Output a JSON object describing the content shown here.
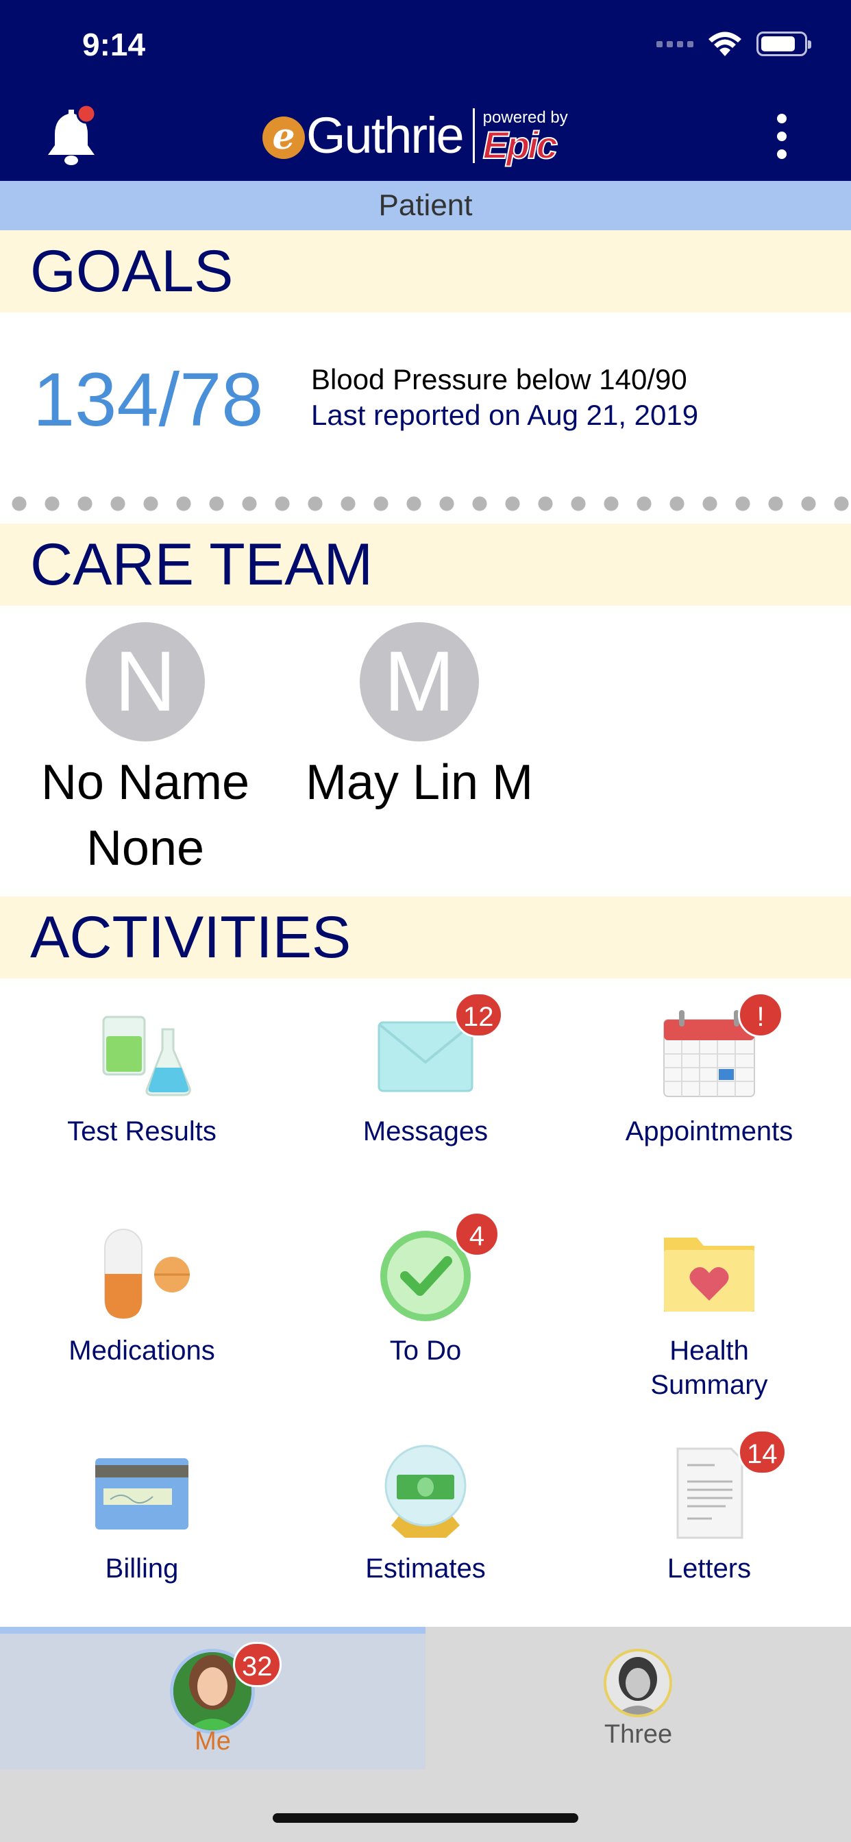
{
  "status_bar": {
    "time": "9:14"
  },
  "header": {
    "logo_e": "e",
    "logo_brand": "Guthrie",
    "logo_powered_by": "powered by",
    "logo_partner": "Epic"
  },
  "patient_bar": {
    "label": "Patient"
  },
  "goals": {
    "heading": "GOALS",
    "value": "134/78",
    "title": "Blood Pressure below 140/90",
    "last_reported": "Last reported on Aug 21, 2019"
  },
  "care_team": {
    "heading": "CARE TEAM",
    "members": [
      {
        "initial": "N",
        "name_line1": "No Name",
        "name_line2": "None"
      },
      {
        "initial": "M",
        "name_line1": "May Lin M",
        "name_line2": ""
      }
    ]
  },
  "activities": {
    "heading": "ACTIVITIES",
    "items": [
      {
        "label": "Test Results",
        "icon": "test-results-icon",
        "badge": ""
      },
      {
        "label": "Messages",
        "icon": "envelope-icon",
        "badge": "12"
      },
      {
        "label": "Appointments",
        "icon": "calendar-icon",
        "badge": "!"
      },
      {
        "label": "Medications",
        "icon": "pill-icon",
        "badge": ""
      },
      {
        "label": "To Do",
        "icon": "checkmark-icon",
        "badge": "4"
      },
      {
        "label": "Health Summary",
        "label_line1": "Health",
        "label_line2": "Summary",
        "icon": "folder-heart-icon",
        "badge": ""
      },
      {
        "label": "Billing",
        "icon": "credit-card-icon",
        "badge": ""
      },
      {
        "label": "Estimates",
        "icon": "estimate-globe-icon",
        "badge": ""
      },
      {
        "label": "Letters",
        "icon": "document-icon",
        "badge": "14"
      }
    ]
  },
  "tabbar": {
    "tabs": [
      {
        "label": "Me",
        "badge": "32",
        "selected": true
      },
      {
        "label": "Three",
        "badge": "",
        "selected": false
      }
    ]
  },
  "colors": {
    "header_bg": "#000a6b",
    "patient_bar_bg": "#a7c5f0",
    "section_bg": "#fef7dc",
    "accent_text": "#000a6b",
    "goal_value": "#4a90d9",
    "badge": "#d83a34",
    "me_tab_label": "#d9752a"
  }
}
